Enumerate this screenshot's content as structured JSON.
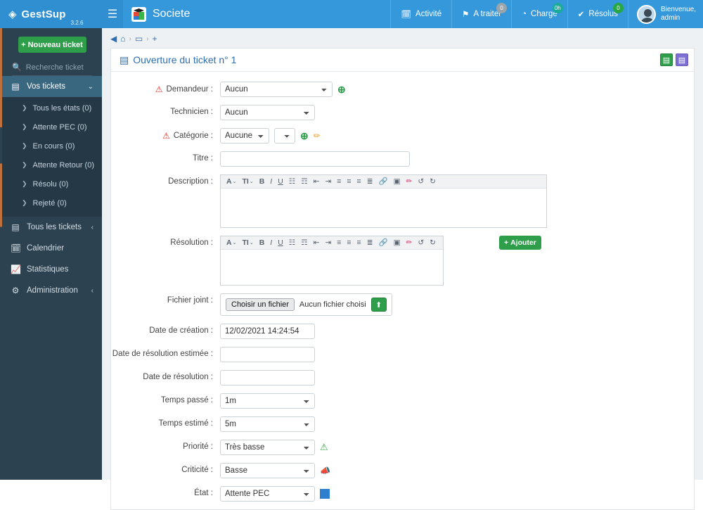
{
  "app": {
    "brand_name": "GestSup",
    "version": "3.2.6",
    "company": "Societe",
    "menu_icon": "hamburger-icon",
    "logo_icon": "gestsup-diamond-icon"
  },
  "topnav": {
    "items": [
      {
        "label": "Activité",
        "icon": "calendar-icon",
        "badge": "",
        "badge_color": ""
      },
      {
        "label": "A traiter",
        "icon": "flag-icon",
        "badge": "0",
        "badge_color": "#9aa5ab"
      },
      {
        "label": "Charge",
        "icon": "gauge-icon",
        "badge": "0h",
        "badge_color": "#1aab9b"
      },
      {
        "label": "Résolus",
        "icon": "check-icon",
        "badge": "0",
        "badge_color": "#27a844"
      }
    ],
    "user": {
      "greeting": "Bienvenue,",
      "name": "admin"
    }
  },
  "sidebar": {
    "new_ticket_label": "Nouveau ticket",
    "search_placeholder": "Recherche ticket",
    "group": {
      "label": "Vos tickets",
      "icon": "ticket-icon",
      "chevron": "⌄"
    },
    "sub_items": [
      {
        "label": "Tous les états (0)"
      },
      {
        "label": "Attente PEC (0)"
      },
      {
        "label": "En cours (0)"
      },
      {
        "label": "Attente Retour (0)"
      },
      {
        "label": "Résolu (0)"
      },
      {
        "label": "Rejeté (0)"
      }
    ],
    "items": [
      {
        "label": "Tous les tickets",
        "icon": "ticket-icon",
        "chevron": "‹"
      },
      {
        "label": "Calendrier",
        "icon": "calendar-icon",
        "chevron": ""
      },
      {
        "label": "Statistiques",
        "icon": "chart-icon",
        "chevron": ""
      },
      {
        "label": "Administration",
        "icon": "gears-icon",
        "chevron": "‹"
      }
    ]
  },
  "breadcrumb": {
    "back": "◀",
    "home": "⌂",
    "sep": "›",
    "ticket": "▭",
    "add": "+"
  },
  "panel": {
    "title": "Ouverture du ticket n° 1",
    "title_icon": "ticket-icon",
    "save_label": "💾",
    "save_alt_label": "💾"
  },
  "form": {
    "demandeur": {
      "label": "Demandeur :",
      "value": "Aucun",
      "required": true,
      "add_label": "+"
    },
    "technicien": {
      "label": "Technicien :",
      "value": "Aucun"
    },
    "categorie": {
      "label": "Catégorie :",
      "value": "Aucune",
      "sub_value": "",
      "required": true,
      "add_label": "+",
      "edit_label": "✎"
    },
    "titre": {
      "label": "Titre :",
      "value": ""
    },
    "description": {
      "label": "Description :",
      "value": ""
    },
    "resolution": {
      "label": "Résolution :",
      "value": "",
      "add_button": "Ajouter"
    },
    "fichier": {
      "label": "Fichier joint :",
      "button": "Choisir un fichier",
      "status": "Aucun fichier choisi",
      "upload_icon": "upload-icon"
    },
    "date_creation": {
      "label": "Date de création :",
      "value": "12/02/2021 14:24:54"
    },
    "date_resolution_estimee": {
      "label": "Date de résolution estimée :",
      "value": ""
    },
    "date_resolution": {
      "label": "Date de résolution :",
      "value": ""
    },
    "temps_passe": {
      "label": "Temps passé :",
      "value": "1m"
    },
    "temps_estime": {
      "label": "Temps estimé :",
      "value": "5m"
    },
    "priorite": {
      "label": "Priorité :",
      "value": "Très basse",
      "icon": "warning-triangle-green-icon"
    },
    "criticite": {
      "label": "Criticité :",
      "value": "Basse",
      "icon": "megaphone-icon"
    },
    "etat": {
      "label": "État :",
      "value": "Attente PEC",
      "color": "#2f7fd0"
    }
  },
  "editor_toolbar": {
    "buttons": [
      {
        "name": "font-color",
        "glyph": "A"
      },
      {
        "name": "font-size",
        "glyph": "TI"
      },
      {
        "name": "bold",
        "glyph": "B"
      },
      {
        "name": "italic",
        "glyph": "I"
      },
      {
        "name": "underline",
        "glyph": "U"
      },
      {
        "name": "bullet-list",
        "glyph": "☰"
      },
      {
        "name": "numbered-list",
        "glyph": "☰"
      },
      {
        "name": "outdent",
        "glyph": "⇤"
      },
      {
        "name": "indent",
        "glyph": "⇥"
      },
      {
        "name": "align-left",
        "glyph": "≡"
      },
      {
        "name": "align-center",
        "glyph": "≡"
      },
      {
        "name": "align-right",
        "glyph": "≡"
      },
      {
        "name": "justify",
        "glyph": "≡"
      },
      {
        "name": "link",
        "glyph": "🔗"
      },
      {
        "name": "image",
        "glyph": "▣"
      },
      {
        "name": "highlighter",
        "glyph": "✏"
      },
      {
        "name": "undo",
        "glyph": "↺"
      },
      {
        "name": "redo",
        "glyph": "↻"
      }
    ]
  },
  "colors": {
    "header_blue": "#3498db",
    "brand_blue": "#2f8fd0",
    "sidebar_dark": "#2c4251",
    "sidebar_active": "#3a6780",
    "green": "#2e9e4a",
    "purple": "#7d6fd1",
    "link_blue": "#2f6fae"
  }
}
